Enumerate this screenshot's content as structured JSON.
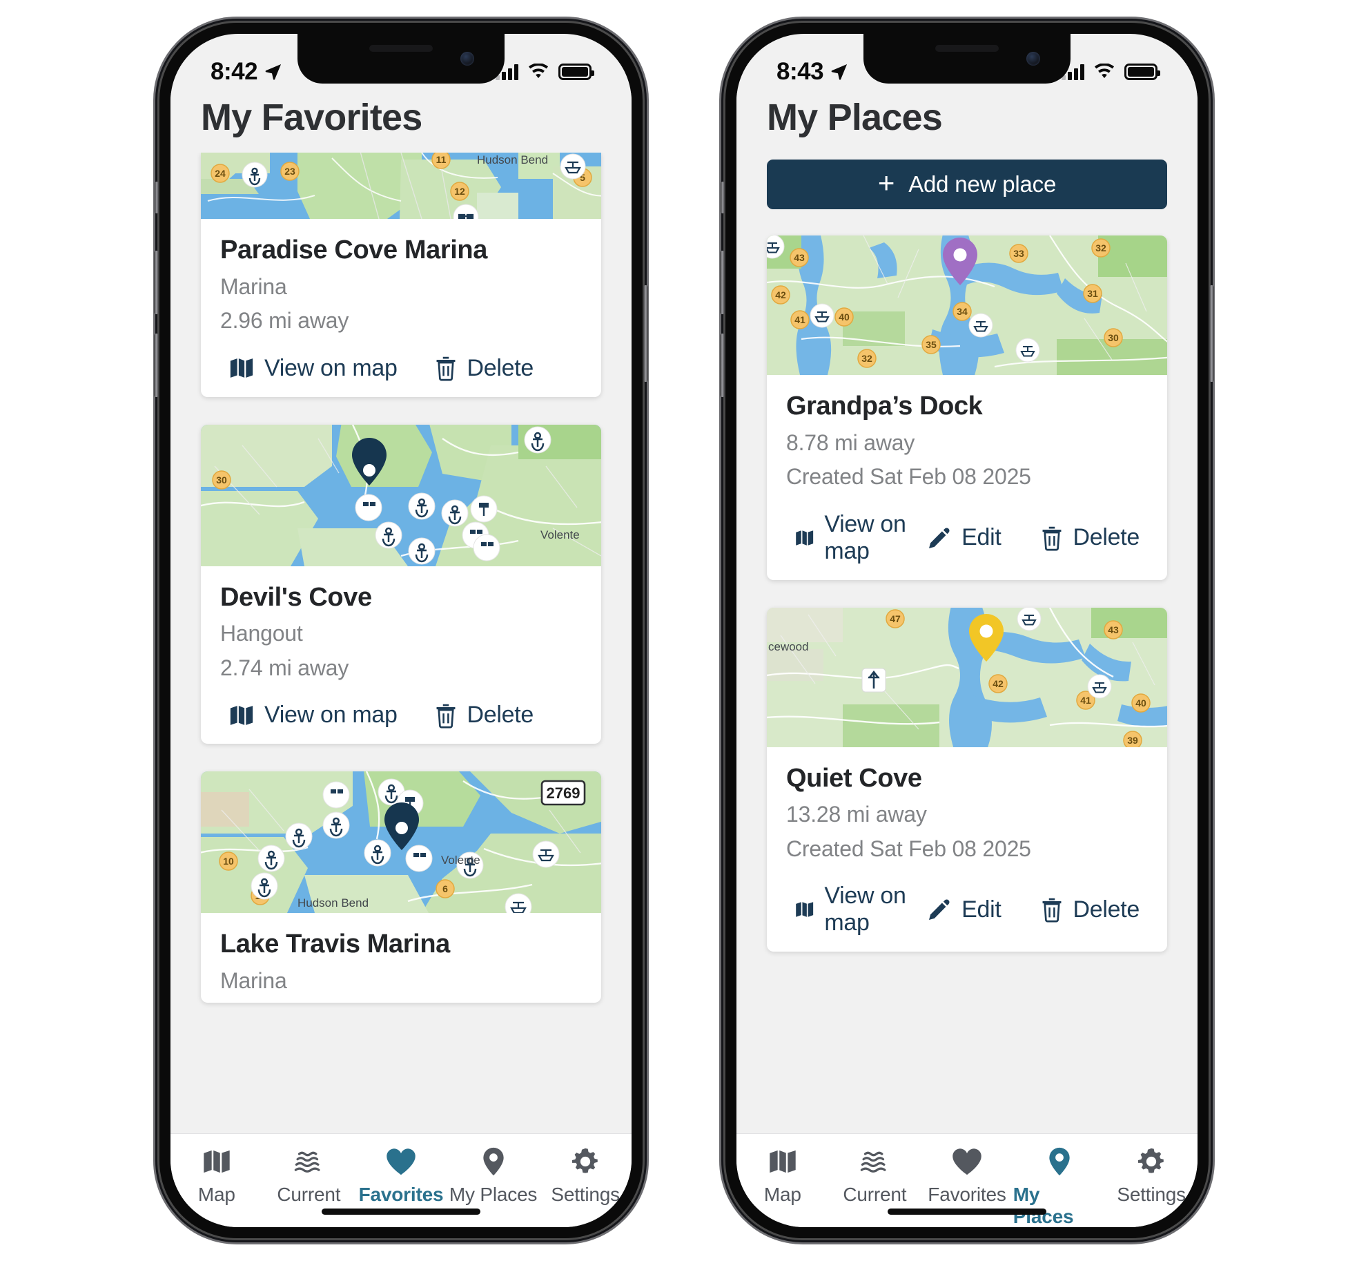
{
  "phones": [
    {
      "id": "favorites-phone",
      "status": {
        "time": "8:42",
        "location_icon": "location-arrow-icon",
        "battery": "full",
        "signal": "3-bars",
        "wifi": "wifi-icon"
      },
      "header": {
        "title": "My Favorites"
      },
      "cards": [
        {
          "name": "Paradise Cove Marina",
          "subtitle": "Marina",
          "distance": "2.96 mi away",
          "actions": [
            {
              "label": "View on map",
              "icon": "map-icon"
            },
            {
              "label": "Delete",
              "icon": "trash-icon"
            }
          ]
        },
        {
          "name": "Devil's Cove",
          "subtitle": "Hangout",
          "distance": "2.74 mi away",
          "actions": [
            {
              "label": "View on map",
              "icon": "map-icon"
            },
            {
              "label": "Delete",
              "icon": "trash-icon"
            }
          ]
        },
        {
          "name": "Lake Travis Marina",
          "subtitle": "Marina",
          "distance": "",
          "actions": []
        }
      ],
      "tabs": [
        {
          "label": "Map",
          "icon": "map-icon",
          "active": false
        },
        {
          "label": "Current",
          "icon": "waves-icon",
          "active": false
        },
        {
          "label": "Favorites",
          "icon": "heart-icon",
          "active": true
        },
        {
          "label": "My Places",
          "icon": "pin-icon",
          "active": false
        },
        {
          "label": "Settings",
          "icon": "gear-icon",
          "active": false
        }
      ]
    },
    {
      "id": "places-phone",
      "status": {
        "time": "8:43",
        "location_icon": "location-arrow-icon",
        "battery": "full",
        "signal": "3-bars",
        "wifi": "wifi-icon"
      },
      "header": {
        "title": "My Places"
      },
      "add_button": {
        "label": "Add new place",
        "icon": "plus-icon"
      },
      "cards": [
        {
          "name": "Grandpa’s Dock",
          "distance": "8.78 mi away",
          "created": "Created Sat Feb 08 2025",
          "pin_color": "#a06fc4",
          "actions": [
            {
              "label": "View on map",
              "icon": "map-icon"
            },
            {
              "label": "Edit",
              "icon": "pencil-icon"
            },
            {
              "label": "Delete",
              "icon": "trash-icon"
            }
          ]
        },
        {
          "name": "Quiet Cove",
          "distance": "13.28 mi away",
          "created": "Created Sat Feb 08 2025",
          "pin_color": "#f2c626",
          "actions": [
            {
              "label": "View on map",
              "icon": "map-icon"
            },
            {
              "label": "Edit",
              "icon": "pencil-icon"
            },
            {
              "label": "Delete",
              "icon": "trash-icon"
            }
          ]
        }
      ],
      "tabs": [
        {
          "label": "Map",
          "icon": "map-icon",
          "active": false
        },
        {
          "label": "Current",
          "icon": "waves-icon",
          "active": false
        },
        {
          "label": "Favorites",
          "icon": "heart-icon",
          "active": false
        },
        {
          "label": "My Places",
          "icon": "pin-icon",
          "active": true
        },
        {
          "label": "Settings",
          "icon": "gear-icon",
          "active": false
        }
      ]
    }
  ],
  "map_labels": {
    "hudson_bend": "Hudson Bend",
    "volente": "Volente",
    "cewood": "cewood",
    "route_shield": "2769",
    "markers_left_1": [
      "24",
      "23",
      "11",
      "12",
      "5"
    ],
    "markers_left_2": [
      "30"
    ],
    "markers_left_3": [
      "10",
      "11",
      "6"
    ],
    "markers_right_1": [
      "43",
      "42",
      "41",
      "40",
      "35",
      "34",
      "33",
      "32",
      "31",
      "30"
    ],
    "markers_right_2": [
      "47",
      "43",
      "42",
      "41",
      "40",
      "39"
    ]
  },
  "colors": {
    "accent_navy": "#1a3a52",
    "accent_teal": "#2a718d",
    "tab_inactive": "#54585f",
    "card_bg": "#ffffff",
    "screen_bg": "#f1f1f1",
    "title_text": "#2e3033",
    "muted_text": "#818386"
  }
}
